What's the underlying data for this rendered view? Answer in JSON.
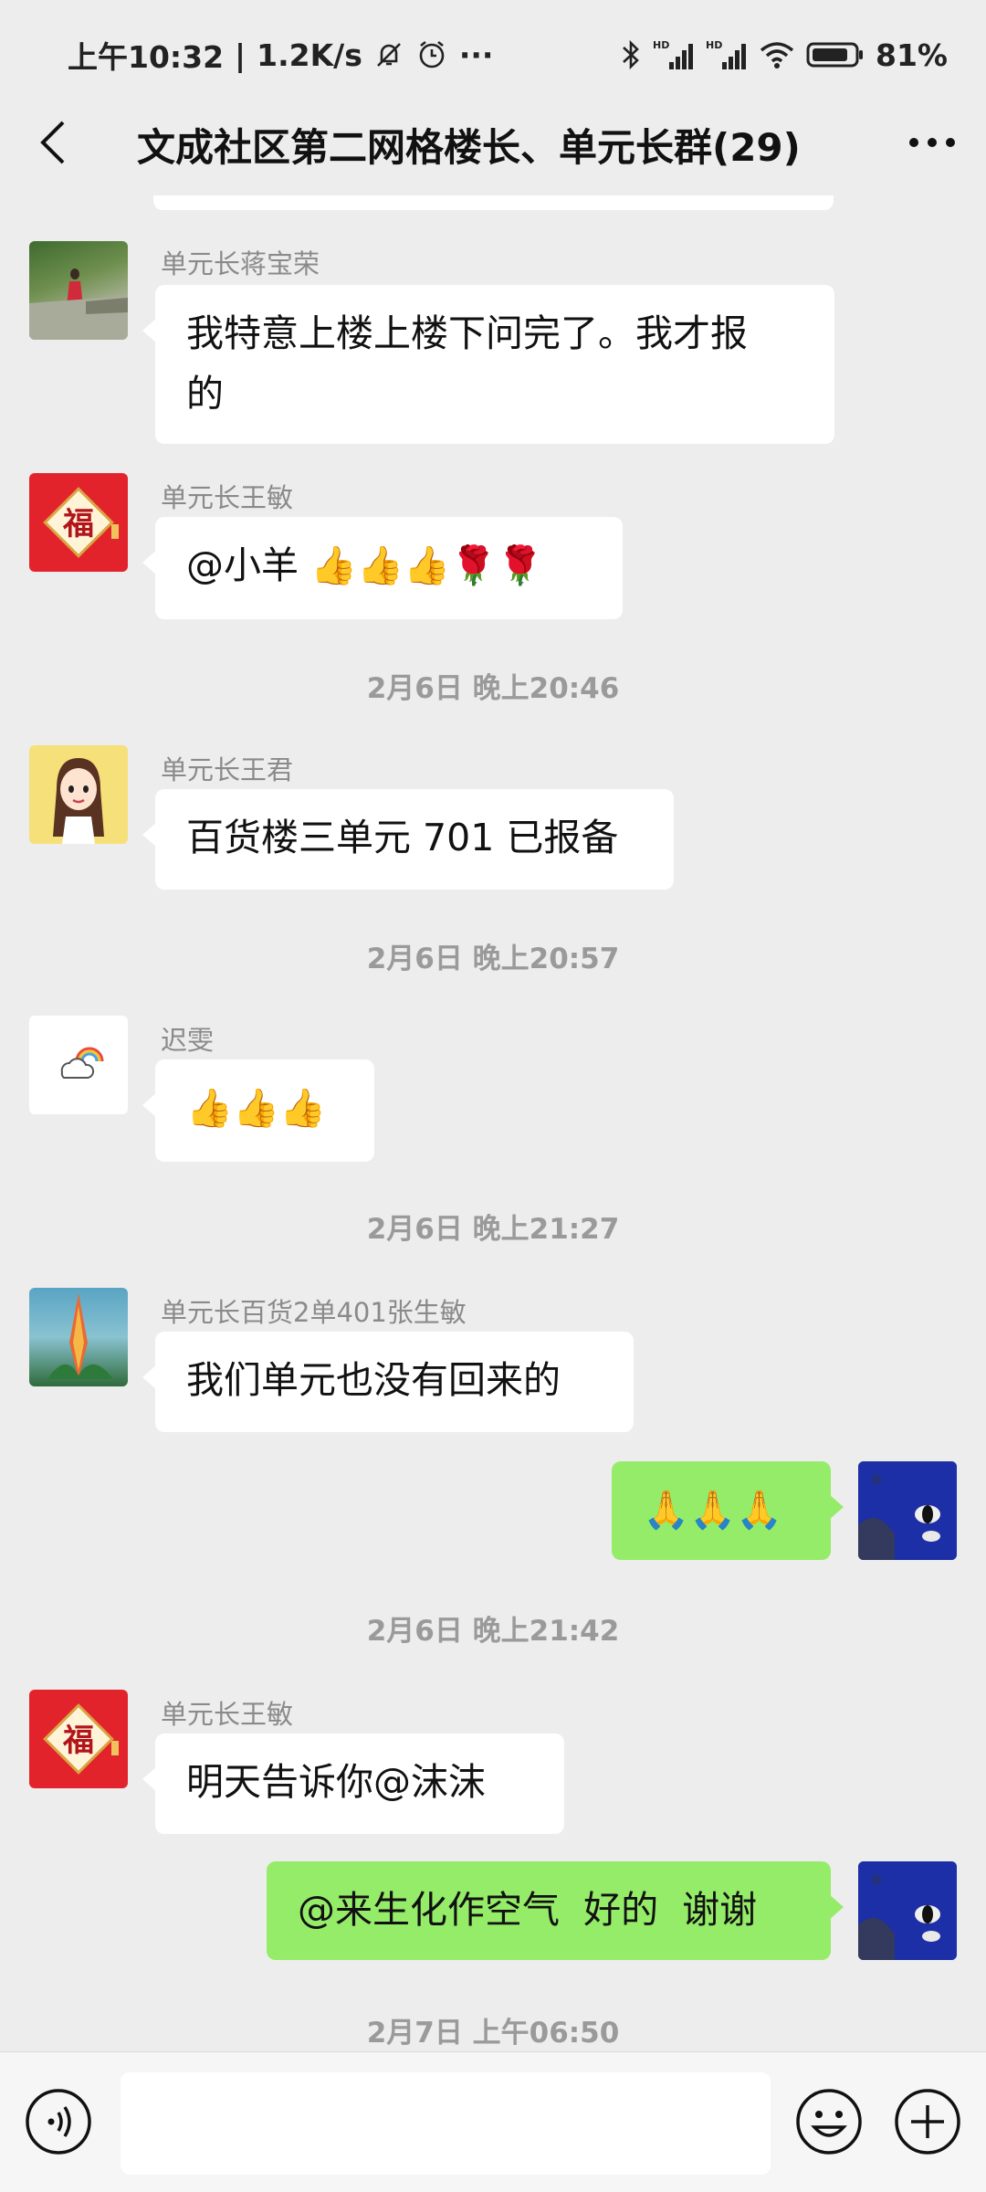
{
  "status_bar": {
    "time": "上午10:32",
    "speed": "1.2K/s",
    "battery": "81%"
  },
  "header": {
    "title": "文成社区第二网格楼长、单元长群(29)"
  },
  "messages": [
    {
      "sender": "单元长蒋宝荣",
      "text_line1": "我特意上楼上楼下问完了。我才报",
      "text_line2": "的"
    },
    {
      "sender": "单元长王敏",
      "text": "@小羊 👍👍👍🌹🌹"
    },
    {
      "timestamp": "2月6日 晚上20:46"
    },
    {
      "sender": "单元长王君",
      "text": "百货楼三单元 701 已报备"
    },
    {
      "timestamp": "2月6日 晚上20:57"
    },
    {
      "sender": "迟雯",
      "text": "👍👍👍"
    },
    {
      "timestamp": "2月6日 晚上21:27"
    },
    {
      "sender": "单元长百货2单401张生敏",
      "text": "我们单元也没有回来的"
    },
    {
      "text": "🙏🙏🙏"
    },
    {
      "timestamp": "2月6日 晚上21:42"
    },
    {
      "sender": "单元长王敏",
      "text": "明天告诉你@沫沫"
    },
    {
      "text": "@来生化作空气  好的  谢谢"
    },
    {
      "timestamp": "2月7日 上午06:50"
    }
  ],
  "avatars": {
    "fu_char": "福"
  },
  "input": {
    "placeholder": ""
  },
  "colors": {
    "outgoing_bubble": "#95ec69",
    "background": "#ededed"
  }
}
